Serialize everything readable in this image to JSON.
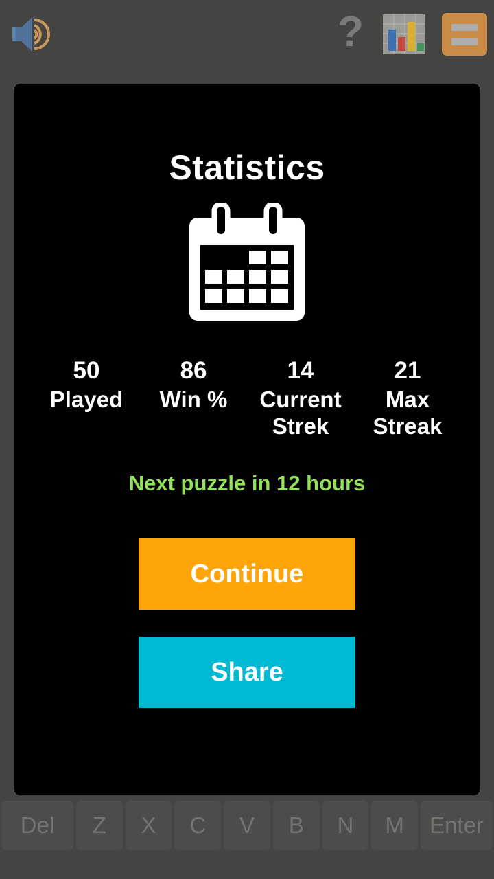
{
  "toolbar": {
    "volume": {
      "name": "volume-icon",
      "label": "Volume"
    },
    "help": {
      "name": "help-icon",
      "glyph": "?"
    },
    "stats": {
      "name": "chart-icon",
      "label": "Statistics"
    },
    "menu": {
      "name": "menu-icon",
      "label": "Menu"
    },
    "background_color": "#454442"
  },
  "modal": {
    "title": "Statistics",
    "background_color": "#000000",
    "calendar_icon": "calendar-icon",
    "stats": [
      {
        "value": "50",
        "label": "Played"
      },
      {
        "value": "86",
        "label": "Win %"
      },
      {
        "value": "14",
        "label": "Current Strek"
      },
      {
        "value": "21",
        "label": "Max Streak"
      }
    ],
    "countdown": "Next puzzle in 12 hours",
    "countdown_color": "#93e05a",
    "buttons": {
      "continue": {
        "label": "Continue",
        "color": "#FFA409"
      },
      "share": {
        "label": "Share",
        "color": "#00BAD4"
      }
    }
  },
  "keyboard": {
    "keys": [
      "Del",
      "Z",
      "X",
      "C",
      "V",
      "B",
      "N",
      "M",
      "Enter"
    ]
  }
}
